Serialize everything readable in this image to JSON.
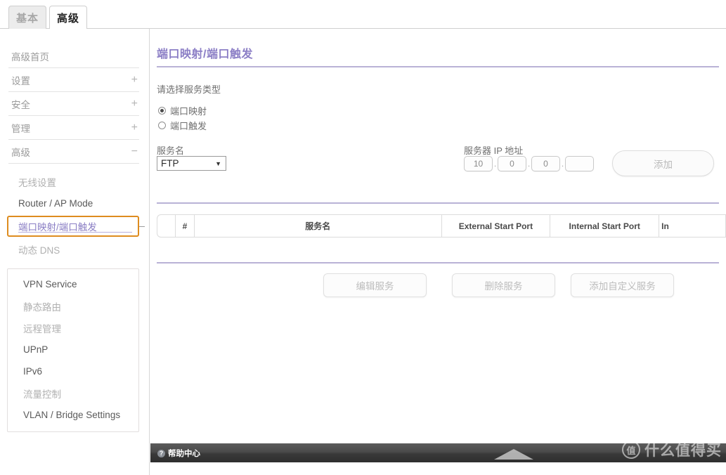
{
  "tabs": [
    {
      "label": "基本",
      "active": false
    },
    {
      "label": "高级",
      "active": true
    }
  ],
  "sidebar": {
    "top_items": [
      {
        "label": "高级首页",
        "expander": ""
      },
      {
        "label": "设置",
        "expander": "+"
      },
      {
        "label": "安全",
        "expander": "+"
      },
      {
        "label": "管理",
        "expander": "+"
      },
      {
        "label": "高级",
        "expander": "−"
      }
    ],
    "sub_items": [
      {
        "label": "无线设置",
        "active": false
      },
      {
        "label": "Router / AP Mode",
        "active": false
      },
      {
        "label": "端口映射/端口触发",
        "active": true
      },
      {
        "label": "动态 DNS",
        "active": false
      }
    ],
    "vpn_group": [
      {
        "label": "VPN Service"
      },
      {
        "label": "静态路由"
      },
      {
        "label": "远程管理"
      },
      {
        "label": "UPnP"
      },
      {
        "label": "IPv6"
      },
      {
        "label": "流量控制"
      },
      {
        "label": "VLAN / Bridge Settings"
      }
    ]
  },
  "main": {
    "title": "端口映射/端口触发",
    "service_type_label": "请选择服务类型",
    "radios": [
      {
        "label": "端口映射",
        "selected": true
      },
      {
        "label": "端口触发",
        "selected": false
      }
    ],
    "service_name_label": "服务名",
    "service_name_value": "FTP",
    "server_ip_label": "服务器 IP 地址",
    "ip_octets": [
      "10",
      "0",
      "0",
      ""
    ],
    "ip_separator": ".",
    "add_button": "添加",
    "table": {
      "columns": [
        "",
        "#",
        "服务名",
        "External Start Port",
        "Internal Start Port",
        "In"
      ]
    },
    "action_buttons": [
      {
        "label": "编辑服务"
      },
      {
        "label": "删除服务"
      },
      {
        "label": "添加自定义服务"
      }
    ]
  },
  "footer": {
    "help_label": "帮助中心",
    "help_icon_glyph": "?",
    "watermark_badge": "值",
    "watermark_text": "什么值得买"
  },
  "colors": {
    "title_purple": "#8c7fc6",
    "divider_purple": "#b9b2d6",
    "active_border_orange": "#de8c1f",
    "active_text_purple": "#8a7ec4"
  }
}
